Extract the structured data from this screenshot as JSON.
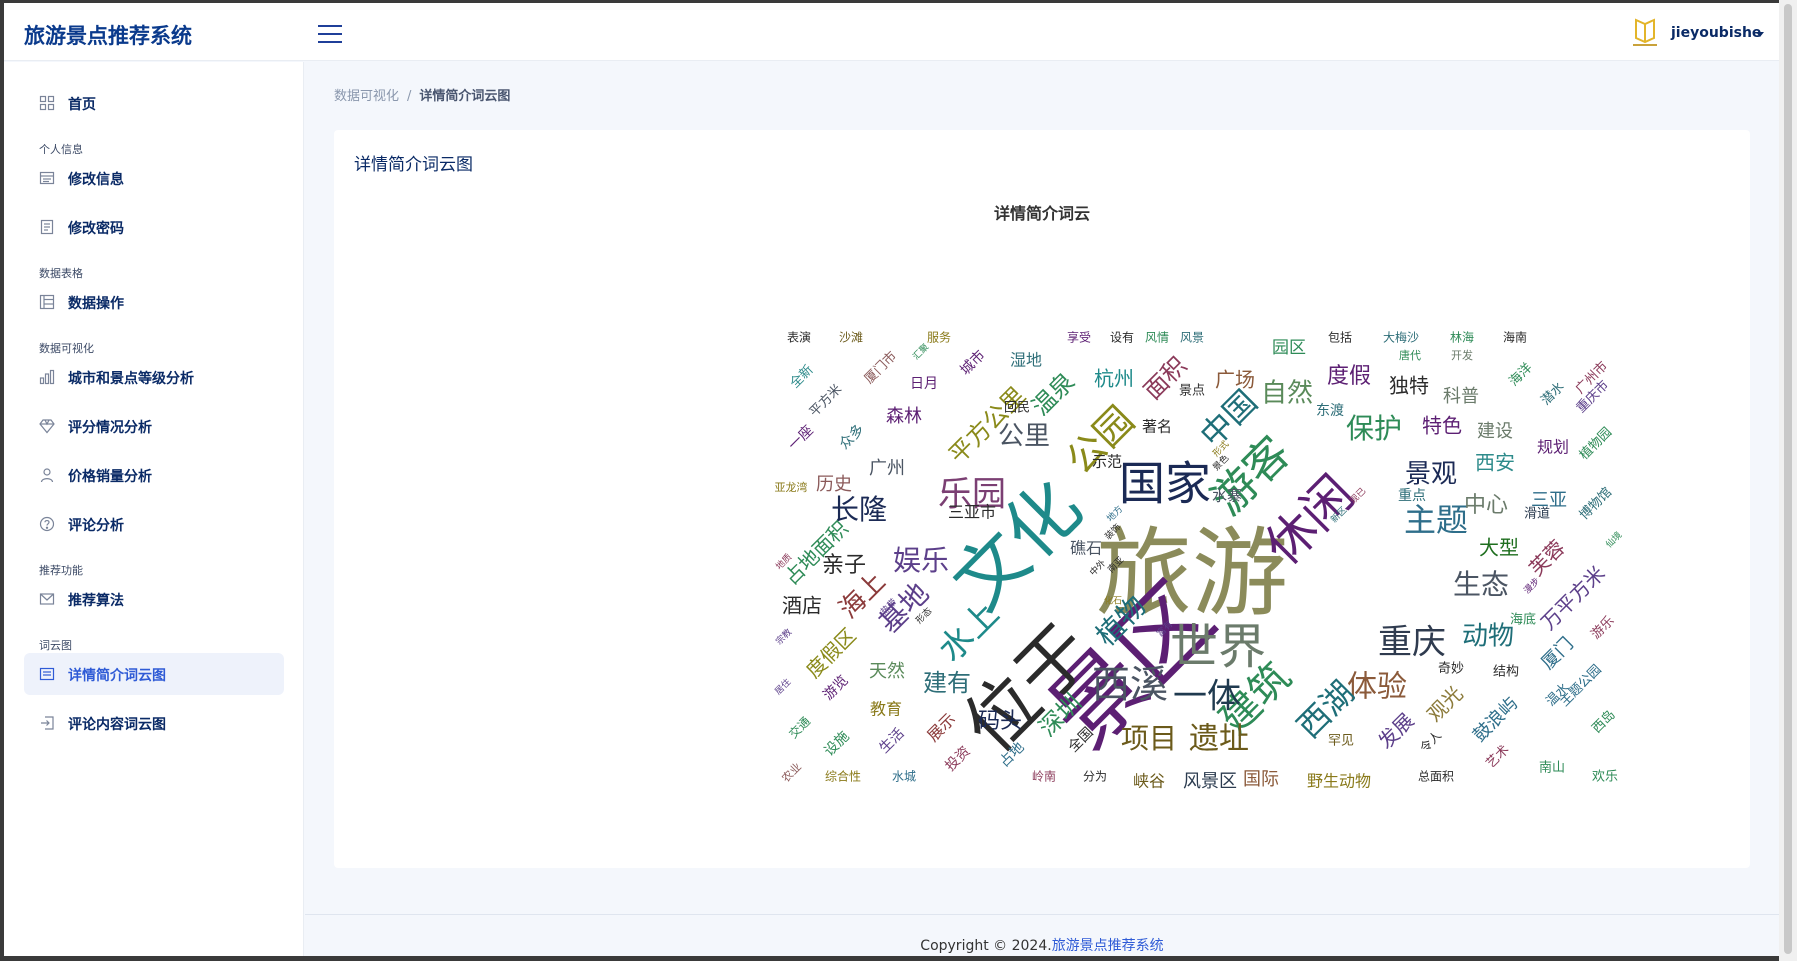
{
  "app": {
    "brand": "旅游景点推荐系统",
    "user": "jieyoubishe"
  },
  "sidebar": {
    "items": [
      {
        "label": "首页",
        "icon": "grid-icon"
      },
      {
        "section": "个人信息"
      },
      {
        "label": "修改信息",
        "icon": "card-icon"
      },
      {
        "label": "修改密码",
        "icon": "document-icon"
      },
      {
        "section": "数据表格"
      },
      {
        "label": "数据操作",
        "icon": "table-icon"
      },
      {
        "section": "数据可视化"
      },
      {
        "label": "城市和景点等级分析",
        "icon": "bar-chart-icon"
      },
      {
        "label": "评分情况分析",
        "icon": "diamond-icon"
      },
      {
        "label": "价格销量分析",
        "icon": "user-icon"
      },
      {
        "label": "评论分析",
        "icon": "help-circle-icon"
      },
      {
        "section": "推荐功能"
      },
      {
        "label": "推荐算法",
        "icon": "mail-icon"
      },
      {
        "section": "词云图"
      },
      {
        "label": "详情简介词云图",
        "icon": "panel-icon",
        "active": true
      },
      {
        "label": "评论内容词云图",
        "icon": "login-icon"
      }
    ]
  },
  "breadcrumb": {
    "parent": "数据可视化",
    "separator": "/",
    "current": "详情简介词云图"
  },
  "card": {
    "title": "详情简介词云图",
    "chart_title": "详情简介词云"
  },
  "footer": {
    "prefix": "Copyright © 2024.",
    "link": "旅游景点推荐系统"
  },
  "colors": {
    "brand": "#0a3a8c",
    "active": "#2f5bd6",
    "bg": "#f4f7fc"
  },
  "wordcloud": [
    [
      "旅游",
      96,
      "#8b8b5a"
    ],
    [
      "景区",
      92,
      "#5c1f73"
    ],
    [
      "文化",
      72,
      "#1e8a8a"
    ],
    [
      "位于",
      72,
      "#2b2b2b"
    ],
    [
      "休闲",
      50,
      "#5c1f73"
    ],
    [
      "国家",
      46,
      "#1b2a55"
    ],
    [
      "世界",
      48,
      "#6b7b6b"
    ],
    [
      "游客",
      44,
      "#2e8b57"
    ],
    [
      "西溪",
      38,
      "#4b5563"
    ],
    [
      "重庆",
      34,
      "#2f3b4f"
    ],
    [
      "建筑",
      40,
      "#2e8b57"
    ],
    [
      "一体",
      34,
      "#1f3a4f"
    ],
    [
      "公园",
      38,
      "#8a8a1a"
    ],
    [
      "乐园",
      34,
      "#7b3f73"
    ],
    [
      "中国",
      32,
      "#1e6e78"
    ],
    [
      "水上",
      34,
      "#1e8a8a"
    ],
    [
      "主题",
      32,
      "#2e6e8a"
    ],
    [
      "体验",
      30,
      "#8b5a3a"
    ],
    [
      "西湖",
      32,
      "#1e6e78"
    ],
    [
      "娱乐",
      28,
      "#5c3f8a"
    ],
    [
      "植物",
      28,
      "#1e6e78"
    ],
    [
      "基地",
      28,
      "#5c3f8a"
    ],
    [
      "长隆",
      28,
      "#1b2a55"
    ],
    [
      "遗址",
      30,
      "#6b5a1a"
    ],
    [
      "项目",
      28,
      "#6b5a1a"
    ],
    [
      "景观",
      26,
      "#1b2a55"
    ],
    [
      "生态",
      28,
      "#4b5563"
    ],
    [
      "保护",
      28,
      "#2e8b57"
    ],
    [
      "自然",
      26,
      "#5a8a5a"
    ],
    [
      "公里",
      26,
      "#4b5563"
    ],
    [
      "动物",
      26,
      "#1e6e78"
    ],
    [
      "海上",
      26,
      "#8b3a3a"
    ],
    [
      "平方公里",
      24,
      "#8a8a1a"
    ],
    [
      "温泉",
      24,
      "#2e8b57"
    ],
    [
      "建有",
      24,
      "#2e6e78"
    ],
    [
      "深圳",
      24,
      "#2e8b57"
    ],
    [
      "面积",
      24,
      "#8b3a5a"
    ],
    [
      "码头",
      22,
      "#1b2a55"
    ],
    [
      "度假",
      22,
      "#5c1f73"
    ],
    [
      "亲子",
      22,
      "#2b2b2b"
    ],
    [
      "中心",
      22,
      "#6b7b6b"
    ],
    [
      "杭州",
      20,
      "#1e8a8a"
    ],
    [
      "广场",
      20,
      "#8b5a3a"
    ],
    [
      "大型",
      20,
      "#1e6e1e"
    ],
    [
      "特色",
      20,
      "#5c1f73"
    ],
    [
      "独特",
      20,
      "#2b2b2b"
    ],
    [
      "西安",
      20,
      "#2e8b8b"
    ],
    [
      "发展",
      20,
      "#5c3f8a"
    ],
    [
      "观光",
      20,
      "#8b7a3a"
    ],
    [
      "芙蓉",
      20,
      "#8b3a5a"
    ],
    [
      "万平方米",
      20,
      "#5c3f8a"
    ],
    [
      "度假区",
      20,
      "#8a8a1a"
    ],
    [
      "酒店",
      20,
      "#2b2b2b"
    ],
    [
      "占地面积",
      20,
      "#2e8b57"
    ],
    [
      "三亚",
      18,
      "#2e6e8a"
    ],
    [
      "天然",
      18,
      "#5a8a5a"
    ],
    [
      "森林",
      18,
      "#5c1f73"
    ],
    [
      "广州",
      18,
      "#4b5563"
    ],
    [
      "历史",
      18,
      "#8b5a5a"
    ],
    [
      "科普",
      18,
      "#6b7b6b"
    ],
    [
      "规划",
      16,
      "#5c1f73"
    ],
    [
      "厦门",
      18,
      "#2e6e8a"
    ],
    [
      "鼓浪屿",
      18,
      "#2e6e8a"
    ],
    [
      "建设",
      18,
      "#6b7b6b"
    ],
    [
      "风景区",
      18,
      "#2b3b4f"
    ],
    [
      "国际",
      18,
      "#8b5a3a"
    ],
    [
      "野生动物",
      16,
      "#8a7a1a"
    ],
    [
      "展示",
      16,
      "#8b3a3a"
    ],
    [
      "教育",
      16,
      "#8a7a1a"
    ],
    [
      "峡谷",
      16,
      "#6b5a1a"
    ],
    [
      "礁石",
      16,
      "#4b5563"
    ],
    [
      "湿地",
      16,
      "#2e6e78"
    ],
    [
      "三亚市",
      16,
      "#2b2b2b"
    ],
    [
      "水寨",
      15,
      "#4b5563"
    ],
    [
      "著名",
      15,
      "#2b2b2b"
    ],
    [
      "示范",
      15,
      "#2b2b2b"
    ],
    [
      "重点",
      14,
      "#2e6e78"
    ],
    [
      "东渡",
      14,
      "#2e6e78"
    ],
    [
      "游览",
      14,
      "#5c1f73"
    ],
    [
      "设施",
      14,
      "#2e8b57"
    ],
    [
      "生活",
      14,
      "#5c3f8a"
    ],
    [
      "投资",
      14,
      "#8b3a5a"
    ],
    [
      "占地",
      14,
      "#2e6e8a"
    ],
    [
      "全国",
      14,
      "#2b2b2b"
    ],
    [
      "城市",
      14,
      "#5c1f73"
    ],
    [
      "日月",
      14,
      "#5c1f73"
    ],
    [
      "众多",
      14,
      "#2e6e78"
    ],
    [
      "一座",
      14,
      "#5c1f73"
    ],
    [
      "全新",
      13,
      "#2e8b8b"
    ],
    [
      "厦门市",
      13,
      "#8b5a5a"
    ],
    [
      "平方米",
      13,
      "#4b5563"
    ],
    [
      "海洋",
      13,
      "#2e8b57"
    ],
    [
      "潜水",
      13,
      "#2e6e78"
    ],
    [
      "广州市",
      13,
      "#8b3a5a"
    ],
    [
      "重庆市",
      13,
      "#5c3f8a"
    ],
    [
      "植物园",
      13,
      "#2e8b57"
    ],
    [
      "博物馆",
      13,
      "#2e6e78"
    ],
    [
      "游乐",
      13,
      "#8b3a5a"
    ],
    [
      "温水",
      13,
      "#2e6e8a"
    ],
    [
      "主题公园",
      13,
      "#2e6e8a"
    ],
    [
      "西岛",
      13,
      "#2e8b57"
    ],
    [
      "欢乐",
      13,
      "#2e8b57"
    ],
    [
      "南山",
      13,
      "#2e8b57"
    ],
    [
      "艺术",
      13,
      "#8b3a5a"
    ],
    [
      "海底",
      13,
      "#2e8b57"
    ],
    [
      "结构",
      13,
      "#2b2b2b"
    ],
    [
      "奇妙",
      13,
      "#2b2b2b"
    ],
    [
      "罕见",
      13,
      "#6b5a1a"
    ],
    [
      "滑道",
      13,
      "#2b3b4f"
    ],
    [
      "回民",
      13,
      "#2b2b2b"
    ],
    [
      "景点",
      13,
      "#2b2b2b"
    ],
    [
      "岭南",
      12,
      "#8b3a5a"
    ],
    [
      "分为",
      12,
      "#2b2b2b"
    ],
    [
      "综合性",
      12,
      "#8a7a1a"
    ],
    [
      "水城",
      12,
      "#2e6e8a"
    ],
    [
      "交通",
      12,
      "#2e8b57"
    ],
    [
      "农业",
      11,
      "#8b5a5a"
    ],
    [
      "总面积",
      12,
      "#2b2b2b"
    ],
    [
      "表演",
      12,
      "#2b2b2b"
    ],
    [
      "沙滩",
      12,
      "#6b5a1a"
    ],
    [
      "服务",
      12,
      "#8a7a1a"
    ],
    [
      "享受",
      12,
      "#5c1f73"
    ],
    [
      "设有",
      12,
      "#2b2b2b"
    ],
    [
      "风情",
      12,
      "#2e8b57"
    ],
    [
      "风景",
      12,
      "#2e6e78"
    ],
    [
      "包括",
      12,
      "#2b2b2b"
    ],
    [
      "大梅沙",
      12,
      "#2e6e78"
    ],
    [
      "林海",
      12,
      "#2e8b57"
    ],
    [
      "海南",
      12,
      "#2b2b2b"
    ],
    [
      "唐代",
      11,
      "#2e8b57"
    ],
    [
      "开发",
      11,
      "#6b7b6b"
    ],
    [
      "亚龙湾",
      11,
      "#8a7a1a"
    ],
    [
      "园区",
      17,
      "#2e8b57"
    ],
    [
      "令人",
      12,
      "#2b2b2b"
    ],
    [
      "仙境",
      9,
      "#2e8b57"
    ],
    [
      "漫步",
      9,
      "#5c1f73"
    ],
    [
      "热带",
      9,
      "#5c3f8a"
    ],
    [
      "宗教",
      9,
      "#5c3f8a"
    ],
    [
      "居住",
      9,
      "#5c3f8a"
    ],
    [
      "汇聚",
      9,
      "#2e8b57"
    ],
    [
      "形态",
      9,
      "#2b2b2b"
    ],
    [
      "化石",
      9,
      "#8a7a1a"
    ],
    [
      "富有",
      9,
      "#5c3f8a"
    ],
    [
      "装饰",
      9,
      "#2b2b2b"
    ],
    [
      "形式",
      9,
      "#8a7a1a"
    ],
    [
      "地方",
      9,
      "#2e6e8a"
    ],
    [
      "地质",
      9,
      "#8b3a5a"
    ],
    [
      "景色",
      9,
      "#2b2b2b"
    ],
    [
      "现已",
      9,
      "#8b3a5a"
    ],
    [
      "新区",
      9,
      "#2e6e78"
    ],
    [
      "中外",
      9,
      "#2b2b2b"
    ],
    [
      "南亚",
      9,
      "#2b2b2b"
    ]
  ]
}
